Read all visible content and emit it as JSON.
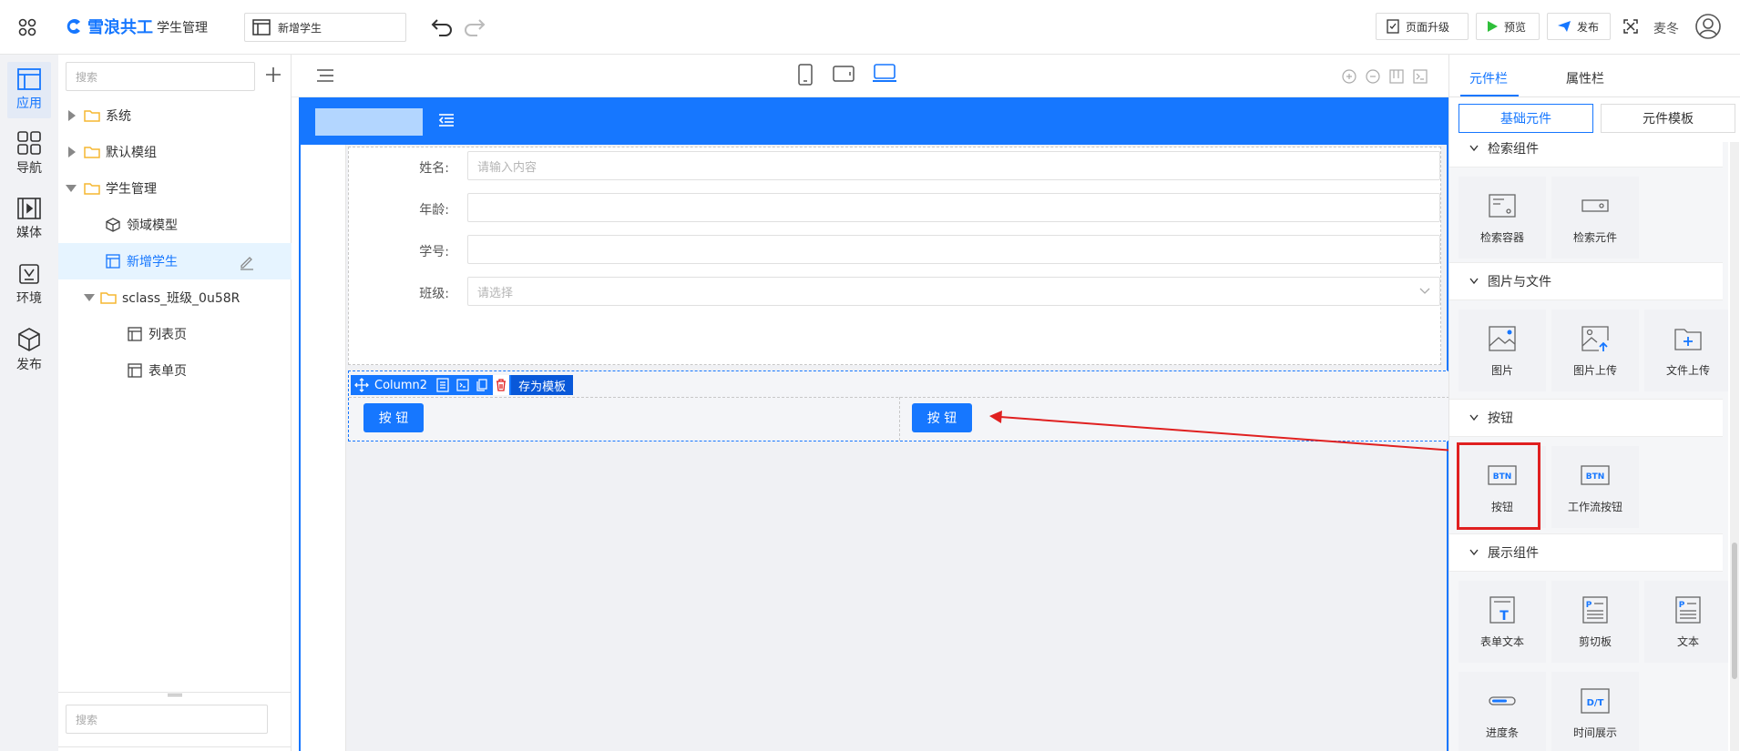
{
  "header": {
    "brand": "雪浪共工",
    "app_name": "学生管理",
    "page_name": "新增学生",
    "upgrade_label": "页面升级",
    "preview_label": "预览",
    "publish_label": "发布",
    "user_name": "麦冬"
  },
  "rail": {
    "items": [
      {
        "label": "应用",
        "icon": "app-icon"
      },
      {
        "label": "导航",
        "icon": "grid-icon"
      },
      {
        "label": "媒体",
        "icon": "media-icon"
      },
      {
        "label": "环境",
        "icon": "env-icon"
      },
      {
        "label": "发布",
        "icon": "cube-icon"
      }
    ]
  },
  "tree": {
    "search_placeholder": "搜索",
    "bottom_search_placeholder": "搜索",
    "items": [
      {
        "label": "系统"
      },
      {
        "label": "默认模组"
      },
      {
        "label": "学生管理"
      },
      {
        "label": "领域模型"
      },
      {
        "label": "新增学生"
      },
      {
        "label": "sclass_班级_0u58R"
      },
      {
        "label": "列表页"
      },
      {
        "label": "表单页"
      }
    ]
  },
  "form": {
    "fields": [
      {
        "label": "姓名:",
        "placeholder": "请输入内容"
      },
      {
        "label": "年龄:",
        "placeholder": ""
      },
      {
        "label": "学号:",
        "placeholder": ""
      },
      {
        "label": "班级:",
        "placeholder": "请选择"
      }
    ]
  },
  "column": {
    "name": "Column2",
    "save_template": "存为模板",
    "button_left": "按 钮",
    "button_right": "按 钮"
  },
  "right_panel": {
    "tab_components": "元件栏",
    "tab_properties": "属性栏",
    "seg_basic": "基础元件",
    "seg_template": "元件模板",
    "partial_section": "检索组件",
    "sections": [
      {
        "title": "图片与文件"
      },
      {
        "title": "按钮"
      },
      {
        "title": "展示组件"
      }
    ],
    "tiles": {
      "search_container": "检索容器",
      "search_element": "检索元件",
      "image": "图片",
      "image_upload": "图片上传",
      "file_upload": "文件上传",
      "button": "按钮",
      "workflow_button": "工作流按钮",
      "form_text": "表单文本",
      "clipboard": "剪切板",
      "text": "文本",
      "progress": "进度条",
      "time_display": "时间展示"
    },
    "btn_icon_text": "BTN",
    "dt_icon_text": "D/T",
    "p_icon_text": "P",
    "t_icon_text": "T"
  },
  "colors": {
    "primary": "#1677ff",
    "highlight": "#e02020",
    "folder": "#f5b731"
  }
}
